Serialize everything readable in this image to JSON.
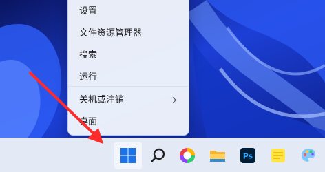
{
  "context_menu": {
    "items": [
      {
        "label": "设置"
      },
      {
        "label": "文件资源管理器"
      },
      {
        "label": "搜索"
      },
      {
        "label": "运行"
      },
      {
        "label": "关机或注销",
        "has_submenu": true
      },
      {
        "label": "桌面"
      }
    ]
  },
  "taskbar": {
    "icons": [
      {
        "name": "start-windows-icon"
      },
      {
        "name": "search-icon"
      },
      {
        "name": "browser-colorful-icon"
      },
      {
        "name": "file-explorer-icon"
      },
      {
        "name": "photoshop-icon",
        "label": "Ps"
      },
      {
        "name": "notes-icon"
      },
      {
        "name": "paint-icon"
      }
    ]
  },
  "colors": {
    "wallpaper_dark": "#0b1a6e",
    "wallpaper_light": "#3a6cff",
    "annotation_arrow": "#ff2a2a",
    "windows_blue": "#1a73e8",
    "ps_blue": "#31a8ff",
    "ps_bg": "#001e36"
  }
}
